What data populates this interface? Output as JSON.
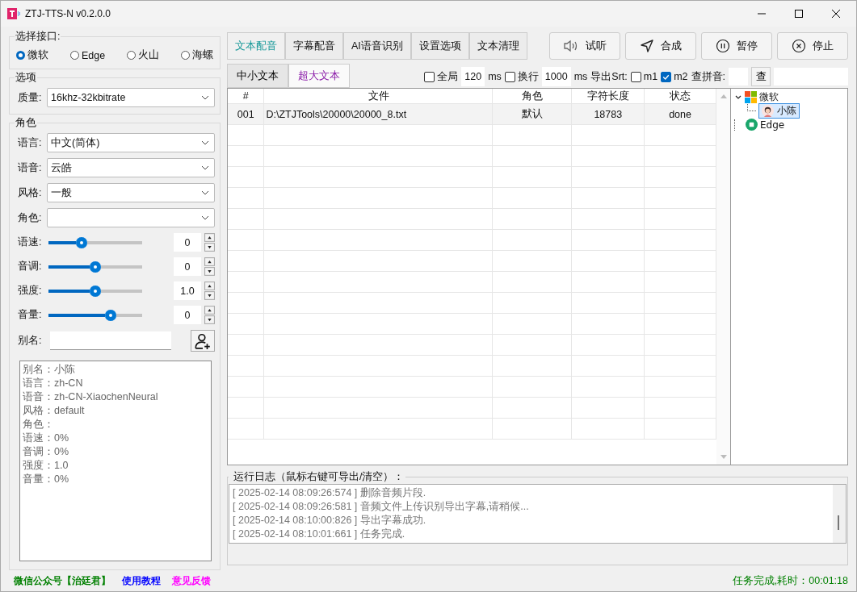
{
  "window": {
    "title": "ZTJ-TTS-N v0.2.0.0"
  },
  "interface": {
    "legend": "选择接口:",
    "options": [
      {
        "label": "微软",
        "selected": true
      },
      {
        "label": "Edge",
        "selected": false
      },
      {
        "label": "火山",
        "selected": false
      },
      {
        "label": "海螺",
        "selected": false
      }
    ]
  },
  "options": {
    "legend": "选项",
    "quality": {
      "label": "质量:",
      "value": "16khz-32kbitrate"
    }
  },
  "role": {
    "legend": "角色",
    "selects": [
      {
        "label": "语言:",
        "value": "中文(简体)"
      },
      {
        "label": "语音:",
        "value": "云皓"
      },
      {
        "label": "风格:",
        "value": "一般"
      },
      {
        "label": "角色:"
      }
    ],
    "sliders": [
      {
        "label": "语速:",
        "level": 0.35,
        "value": "0"
      },
      {
        "label": "音调:",
        "level": 0.5,
        "value": "0"
      },
      {
        "label": "强度:",
        "level": 0.5,
        "value": "1.0"
      },
      {
        "label": "音量:",
        "level": 0.66,
        "value": "0"
      }
    ],
    "alias": {
      "label": "别名:"
    },
    "info": [
      "别名：小陈",
      "语言：zh-CN",
      "语音：zh-CN-XiaochenNeural",
      "风格：default",
      "角色：",
      "语速：0%",
      "音调：0%",
      "强度：1.0",
      "音量：0%"
    ]
  },
  "tabs": [
    {
      "label": "文本配音",
      "selected": true
    },
    {
      "label": "字幕配音",
      "selected": false
    },
    {
      "label": "AI语音识别",
      "selected": false
    },
    {
      "label": "设置选项",
      "selected": false
    },
    {
      "label": "文本清理",
      "selected": false
    }
  ],
  "actions": [
    {
      "label": "试听",
      "kind": "speaker"
    },
    {
      "label": "合成",
      "kind": "send"
    },
    {
      "label": "暂停",
      "kind": "pause"
    },
    {
      "label": "停止",
      "kind": "stop"
    }
  ],
  "subtabs": [
    {
      "label": "中小文本",
      "selected": false
    },
    {
      "label": "超大文本",
      "selected": true
    }
  ],
  "toolbar": {
    "global": {
      "label": "全局",
      "checked": false,
      "value": "120",
      "unit": "ms"
    },
    "newline": {
      "label": "换行",
      "checked": false,
      "value": "1000",
      "unit": "ms"
    },
    "srt_label": "导出Srt:",
    "srt": [
      {
        "label": "m1",
        "checked": false
      },
      {
        "label": "m2",
        "checked": true
      }
    ],
    "pinyin_label": "查拼音:",
    "pinyin_button": "查"
  },
  "table": {
    "columns": [
      "#",
      "文件",
      "角色",
      "字符长度",
      "状态"
    ],
    "rows": [
      [
        "001",
        "D:\\ZTJTools\\20000\\20000_8.txt",
        "默认",
        "18783",
        "done"
      ]
    ]
  },
  "tree": [
    {
      "label": "微软",
      "kind": "microsoft",
      "expanded": true,
      "children": [
        {
          "label": "小陈",
          "kind": "person",
          "selected": true
        }
      ]
    },
    {
      "label": "Edge",
      "kind": "edge"
    }
  ],
  "log": {
    "title": "运行日志（鼠标右键可导出/清空）：",
    "lines": [
      "[ 2025-02-14 08:09:26:574 ] 删除音频片段.",
      "[ 2025-02-14 08:09:26:581 ] 音频文件上传识别导出字幕,请稍候...",
      "[ 2025-02-14 08:10:00:826 ] 导出字幕成功.",
      "[ 2025-02-14 08:10:01:661 ] 任务完成."
    ]
  },
  "footer": {
    "links": [
      {
        "label": "微信公众号【治廷君】",
        "color": "#008000"
      },
      {
        "label": "使用教程",
        "color": "#0000ff"
      },
      {
        "label": "意见反馈",
        "color": "#ff00ff"
      }
    ],
    "status": "任务完成,耗时：00:01:18"
  }
}
